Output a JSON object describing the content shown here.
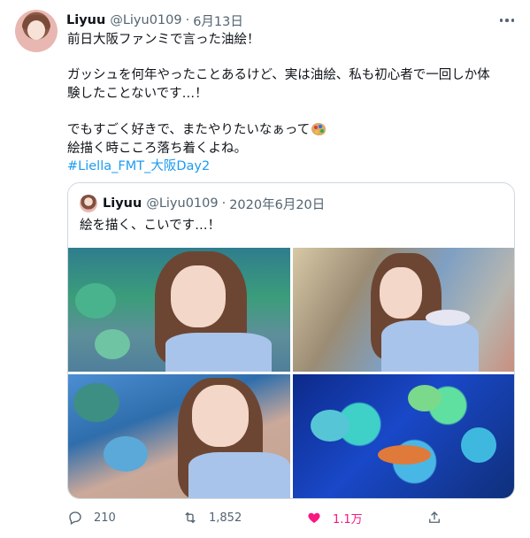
{
  "tweet": {
    "author_name": "Liyuu",
    "author_handle": "@Liyu0109",
    "separator": "·",
    "date": "6月13日",
    "lines": [
      "前日大阪ファンミで言った油絵！",
      "ガッシュを何年やったことあるけど、実は油絵、私も初心者で一回しか体",
      "験したことないです…！",
      "でもすごく好きで、またやりたいなぁって",
      "絵描く時こころ落ち着くよね。"
    ],
    "hashtag": "#Liella_FMT_大阪Day2",
    "emoji_icon": "artist-palette-icon"
  },
  "quoted": {
    "author_name": "Liyuu",
    "author_handle": "@Liyu0109",
    "separator": "·",
    "date": "2020年6月20日",
    "text": "絵を描く、こいです…！"
  },
  "actions": {
    "reply_count": "210",
    "retweet_count": "1,852",
    "like_count": "1.1万",
    "like_color": "#f91880",
    "link_color": "#1d9bf0"
  }
}
